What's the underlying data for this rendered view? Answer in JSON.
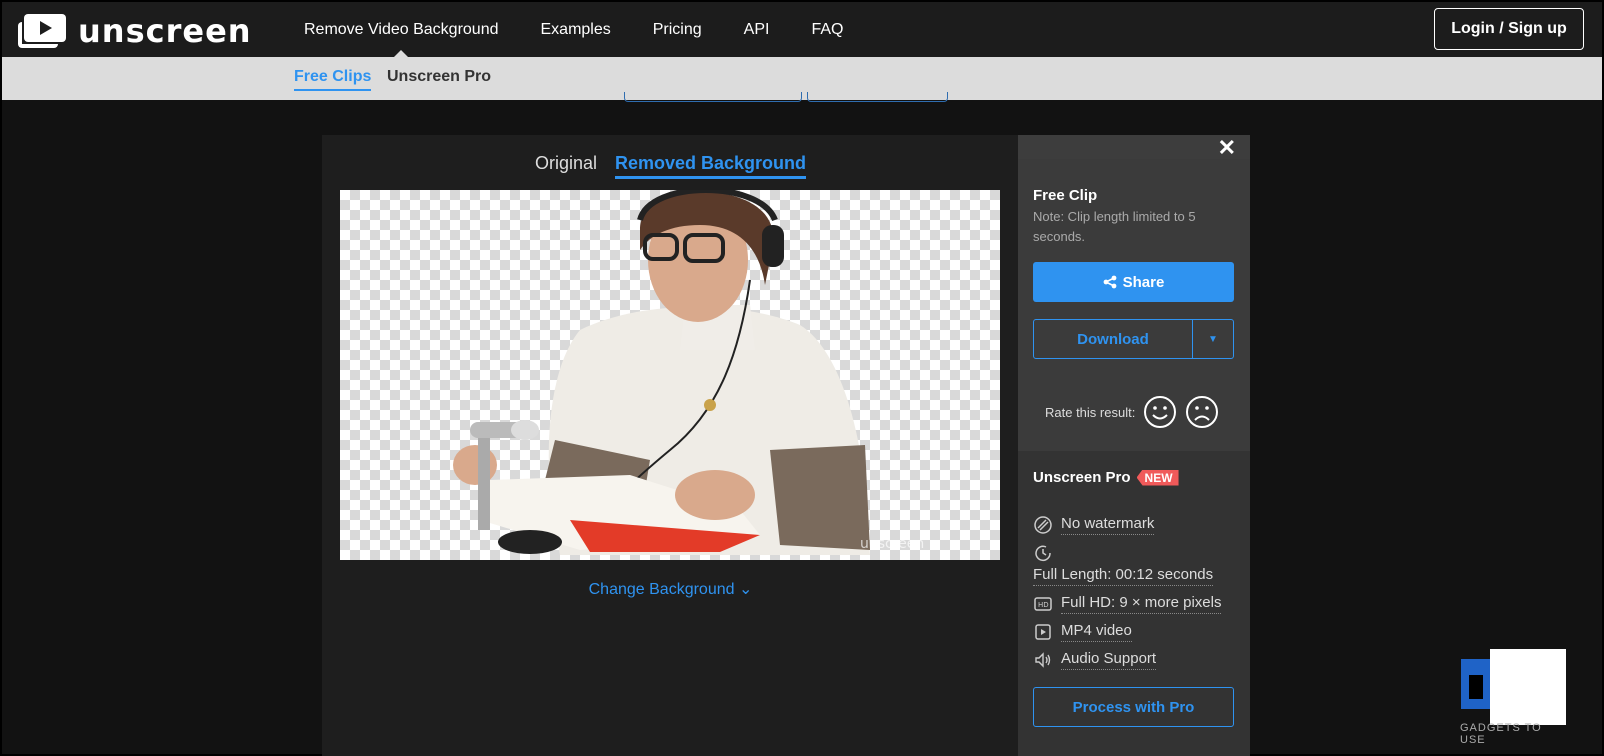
{
  "brand": {
    "name": "unscreen"
  },
  "nav": {
    "items": [
      "Remove Video Background",
      "Examples",
      "Pricing",
      "API",
      "FAQ"
    ],
    "login": "Login / Sign up"
  },
  "subnav": {
    "free_clips": "Free Clips",
    "pro": "Unscreen Pro"
  },
  "view": {
    "original": "Original",
    "removed": "Removed Background",
    "change_background": "Change Background"
  },
  "side": {
    "close": "✕",
    "free_clip_title": "Free Clip",
    "free_clip_note": "Note: Clip length limited to 5 seconds.",
    "share": "Share",
    "download": "Download",
    "rate_label": "Rate this result:",
    "pro_title": "Unscreen Pro",
    "new_badge": "NEW",
    "features": {
      "no_watermark": "No watermark",
      "full_length": "Full Length: 00:12 seconds",
      "full_hd": "Full HD: 9 × more pixels",
      "mp4": "MP4 video",
      "audio": "Audio Support"
    },
    "process_pro": "Process with Pro"
  },
  "watermark": {
    "text": "GADGETS TO USE"
  },
  "colors": {
    "accent": "#2f93f0",
    "badge": "#f05a5a"
  }
}
